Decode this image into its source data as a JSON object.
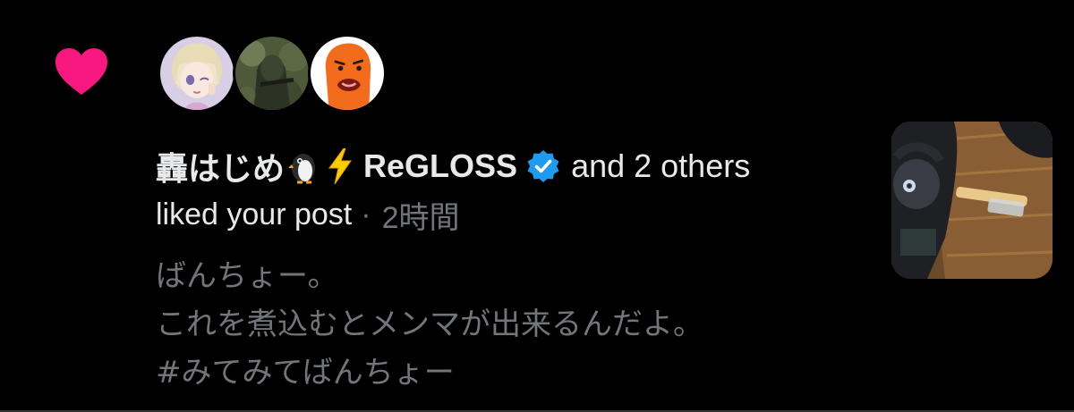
{
  "notification": {
    "type_icon": "heart-icon",
    "heart_color": "#f91880",
    "avatars": [
      {
        "icon": "avatar-anime-girl"
      },
      {
        "icon": "avatar-ghillie-soldier"
      },
      {
        "icon": "avatar-orange-character"
      }
    ],
    "actor_name": "轟はじめ",
    "actor_name_suffix_icons": [
      "penguin-emoji-icon",
      "lightning-emoji-icon"
    ],
    "actor_group": "ReGLOSS",
    "verified_icon": "verified-badge-icon",
    "verified_color": "#1d9bf0",
    "others_text": "and 2 others",
    "action_text": "liked your post",
    "separator": "·",
    "time": "2時間",
    "post_lines": [
      "ばんちょー。",
      "これを煮込むとメンマが出来るんだよ。",
      "#みてみてばんちょー"
    ],
    "thumbnail_icon": "post-image-thumbnail"
  }
}
